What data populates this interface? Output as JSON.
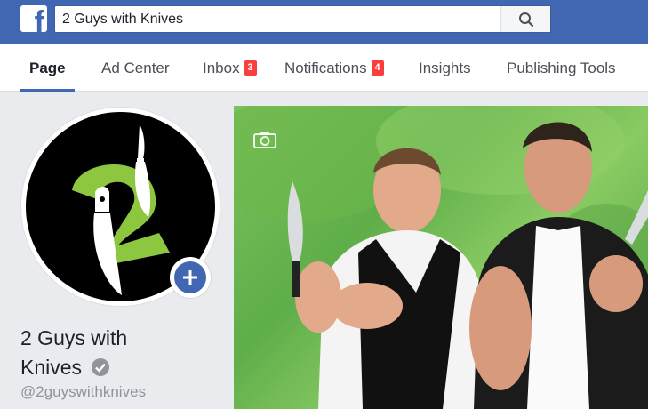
{
  "topbar": {
    "logo_letter": "f",
    "search": {
      "value": "2 Guys with Knives"
    }
  },
  "tabs": [
    {
      "label": "Page",
      "active": true
    },
    {
      "label": "Ad Center"
    },
    {
      "label": "Inbox",
      "badge": "3"
    },
    {
      "label": "Notifications",
      "badge": "4"
    },
    {
      "label": "Insights"
    },
    {
      "label": "Publishing Tools"
    }
  ],
  "profile": {
    "name": "2 Guys with Knives",
    "name_line1": "2 Guys with",
    "name_line2": "Knives",
    "handle": "@2guyswithknives"
  },
  "colors": {
    "brand_blue": "#4267b2",
    "badge_red": "#fa3e3e",
    "logo_green": "#8dc63f"
  }
}
